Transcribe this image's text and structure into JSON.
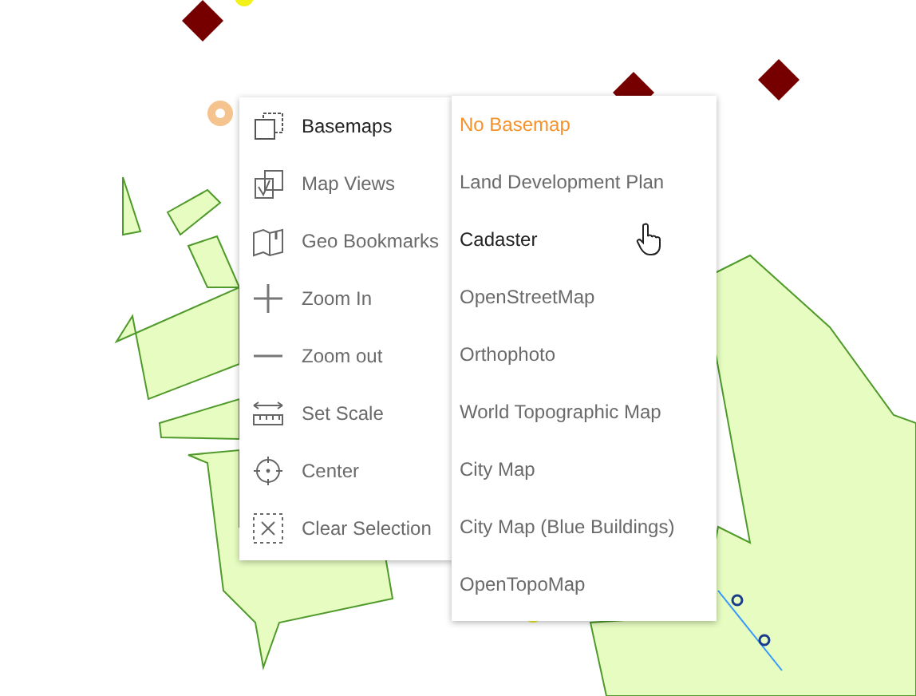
{
  "menu": {
    "items": [
      {
        "label": "Basemaps",
        "kind": "basemaps",
        "selected": true
      },
      {
        "label": "Map Views",
        "kind": "views",
        "selected": false
      },
      {
        "label": "Geo Bookmarks",
        "kind": "bookmarks",
        "selected": false
      },
      {
        "label": "Zoom In",
        "kind": "plus",
        "selected": false
      },
      {
        "label": "Zoom out",
        "kind": "minus",
        "selected": false
      },
      {
        "label": "Set Scale",
        "kind": "scale",
        "selected": false
      },
      {
        "label": "Center",
        "kind": "center",
        "selected": false
      },
      {
        "label": "Clear Selection",
        "kind": "clear",
        "selected": false
      }
    ]
  },
  "submenu": {
    "items": [
      {
        "label": "No Basemap",
        "selected": true,
        "hovered": false
      },
      {
        "label": "Land Development Plan",
        "selected": false,
        "hovered": false
      },
      {
        "label": "Cadaster",
        "selected": false,
        "hovered": true
      },
      {
        "label": "OpenStreetMap",
        "selected": false,
        "hovered": false
      },
      {
        "label": "Orthophoto",
        "selected": false,
        "hovered": false
      },
      {
        "label": "World Topographic Map",
        "selected": false,
        "hovered": false
      },
      {
        "label": "City Map",
        "selected": false,
        "hovered": false
      },
      {
        "label": "City Map (Blue Buildings)",
        "selected": false,
        "hovered": false
      },
      {
        "label": "OpenTopoMap",
        "selected": false,
        "hovered": false
      }
    ]
  }
}
